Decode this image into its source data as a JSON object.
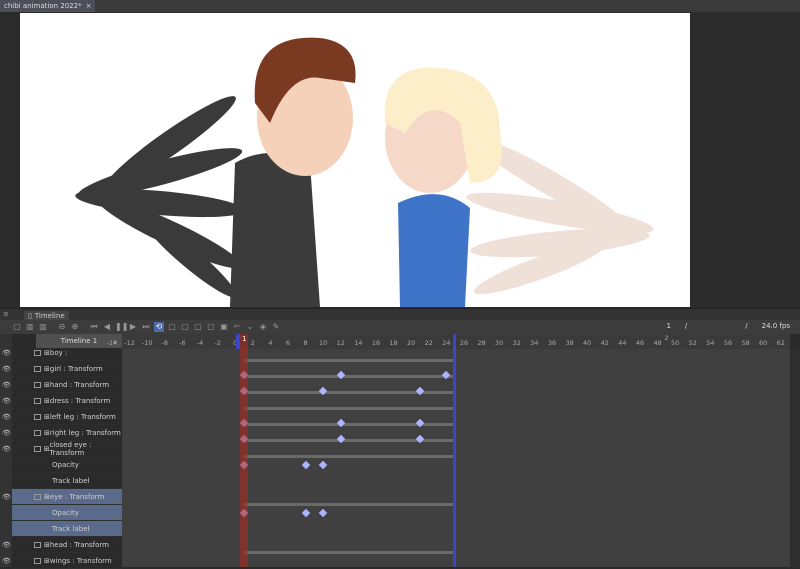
{
  "document_tab": {
    "title": "chibi animation 2022*",
    "close": "×"
  },
  "panel": {
    "tab_label": "Timeline"
  },
  "toolbar": {
    "icons": [
      "zoom-out",
      "zoom-in",
      "first-frame",
      "prev-frame",
      "pause",
      "next-frame",
      "last-frame",
      "loop"
    ]
  },
  "frame_info": {
    "current": "1",
    "sep1": "/",
    "sep2": "/",
    "fps": "24.0 fps"
  },
  "timeline_select": {
    "value": "Timeline 1"
  },
  "ruler": {
    "second_marker": "2",
    "current_frame_label": "1"
  },
  "tracks": [
    {
      "label": "boy :",
      "keyframes": []
    },
    {
      "label": "girl : Transform",
      "keyframes": [
        1,
        12,
        24
      ]
    },
    {
      "label": "hand : Transform",
      "keyframes": [
        1,
        10,
        21
      ]
    },
    {
      "label": "dress : Transform",
      "keyframes": []
    },
    {
      "label": "left leg : Transform",
      "keyframes": [
        1,
        12,
        21
      ]
    },
    {
      "label": "right leg : Transform",
      "keyframes": [
        1,
        12,
        21
      ]
    },
    {
      "label": "closed eye : Transform",
      "keyframes": []
    },
    {
      "label": "Opacity",
      "keyframes": [
        1,
        8,
        10
      ],
      "sub": true
    },
    {
      "label": "Track label",
      "sub": true,
      "keyframes": []
    },
    {
      "label": "eye : Transform",
      "keyframes": [],
      "selected": true
    },
    {
      "label": "Opacity",
      "keyframes": [
        1,
        8,
        10
      ],
      "sub": true,
      "selected": true
    },
    {
      "label": "Track label",
      "sub": true,
      "selected": true,
      "keyframes": []
    },
    {
      "label": "head : Transform",
      "keyframes": []
    },
    {
      "label": "wings : Transform",
      "keyframes": []
    }
  ],
  "colors": {
    "playhead": "#b4281e",
    "keyframe": "#aab4ff",
    "selection": "#5a6a8a",
    "end_marker": "#3a46c8"
  }
}
